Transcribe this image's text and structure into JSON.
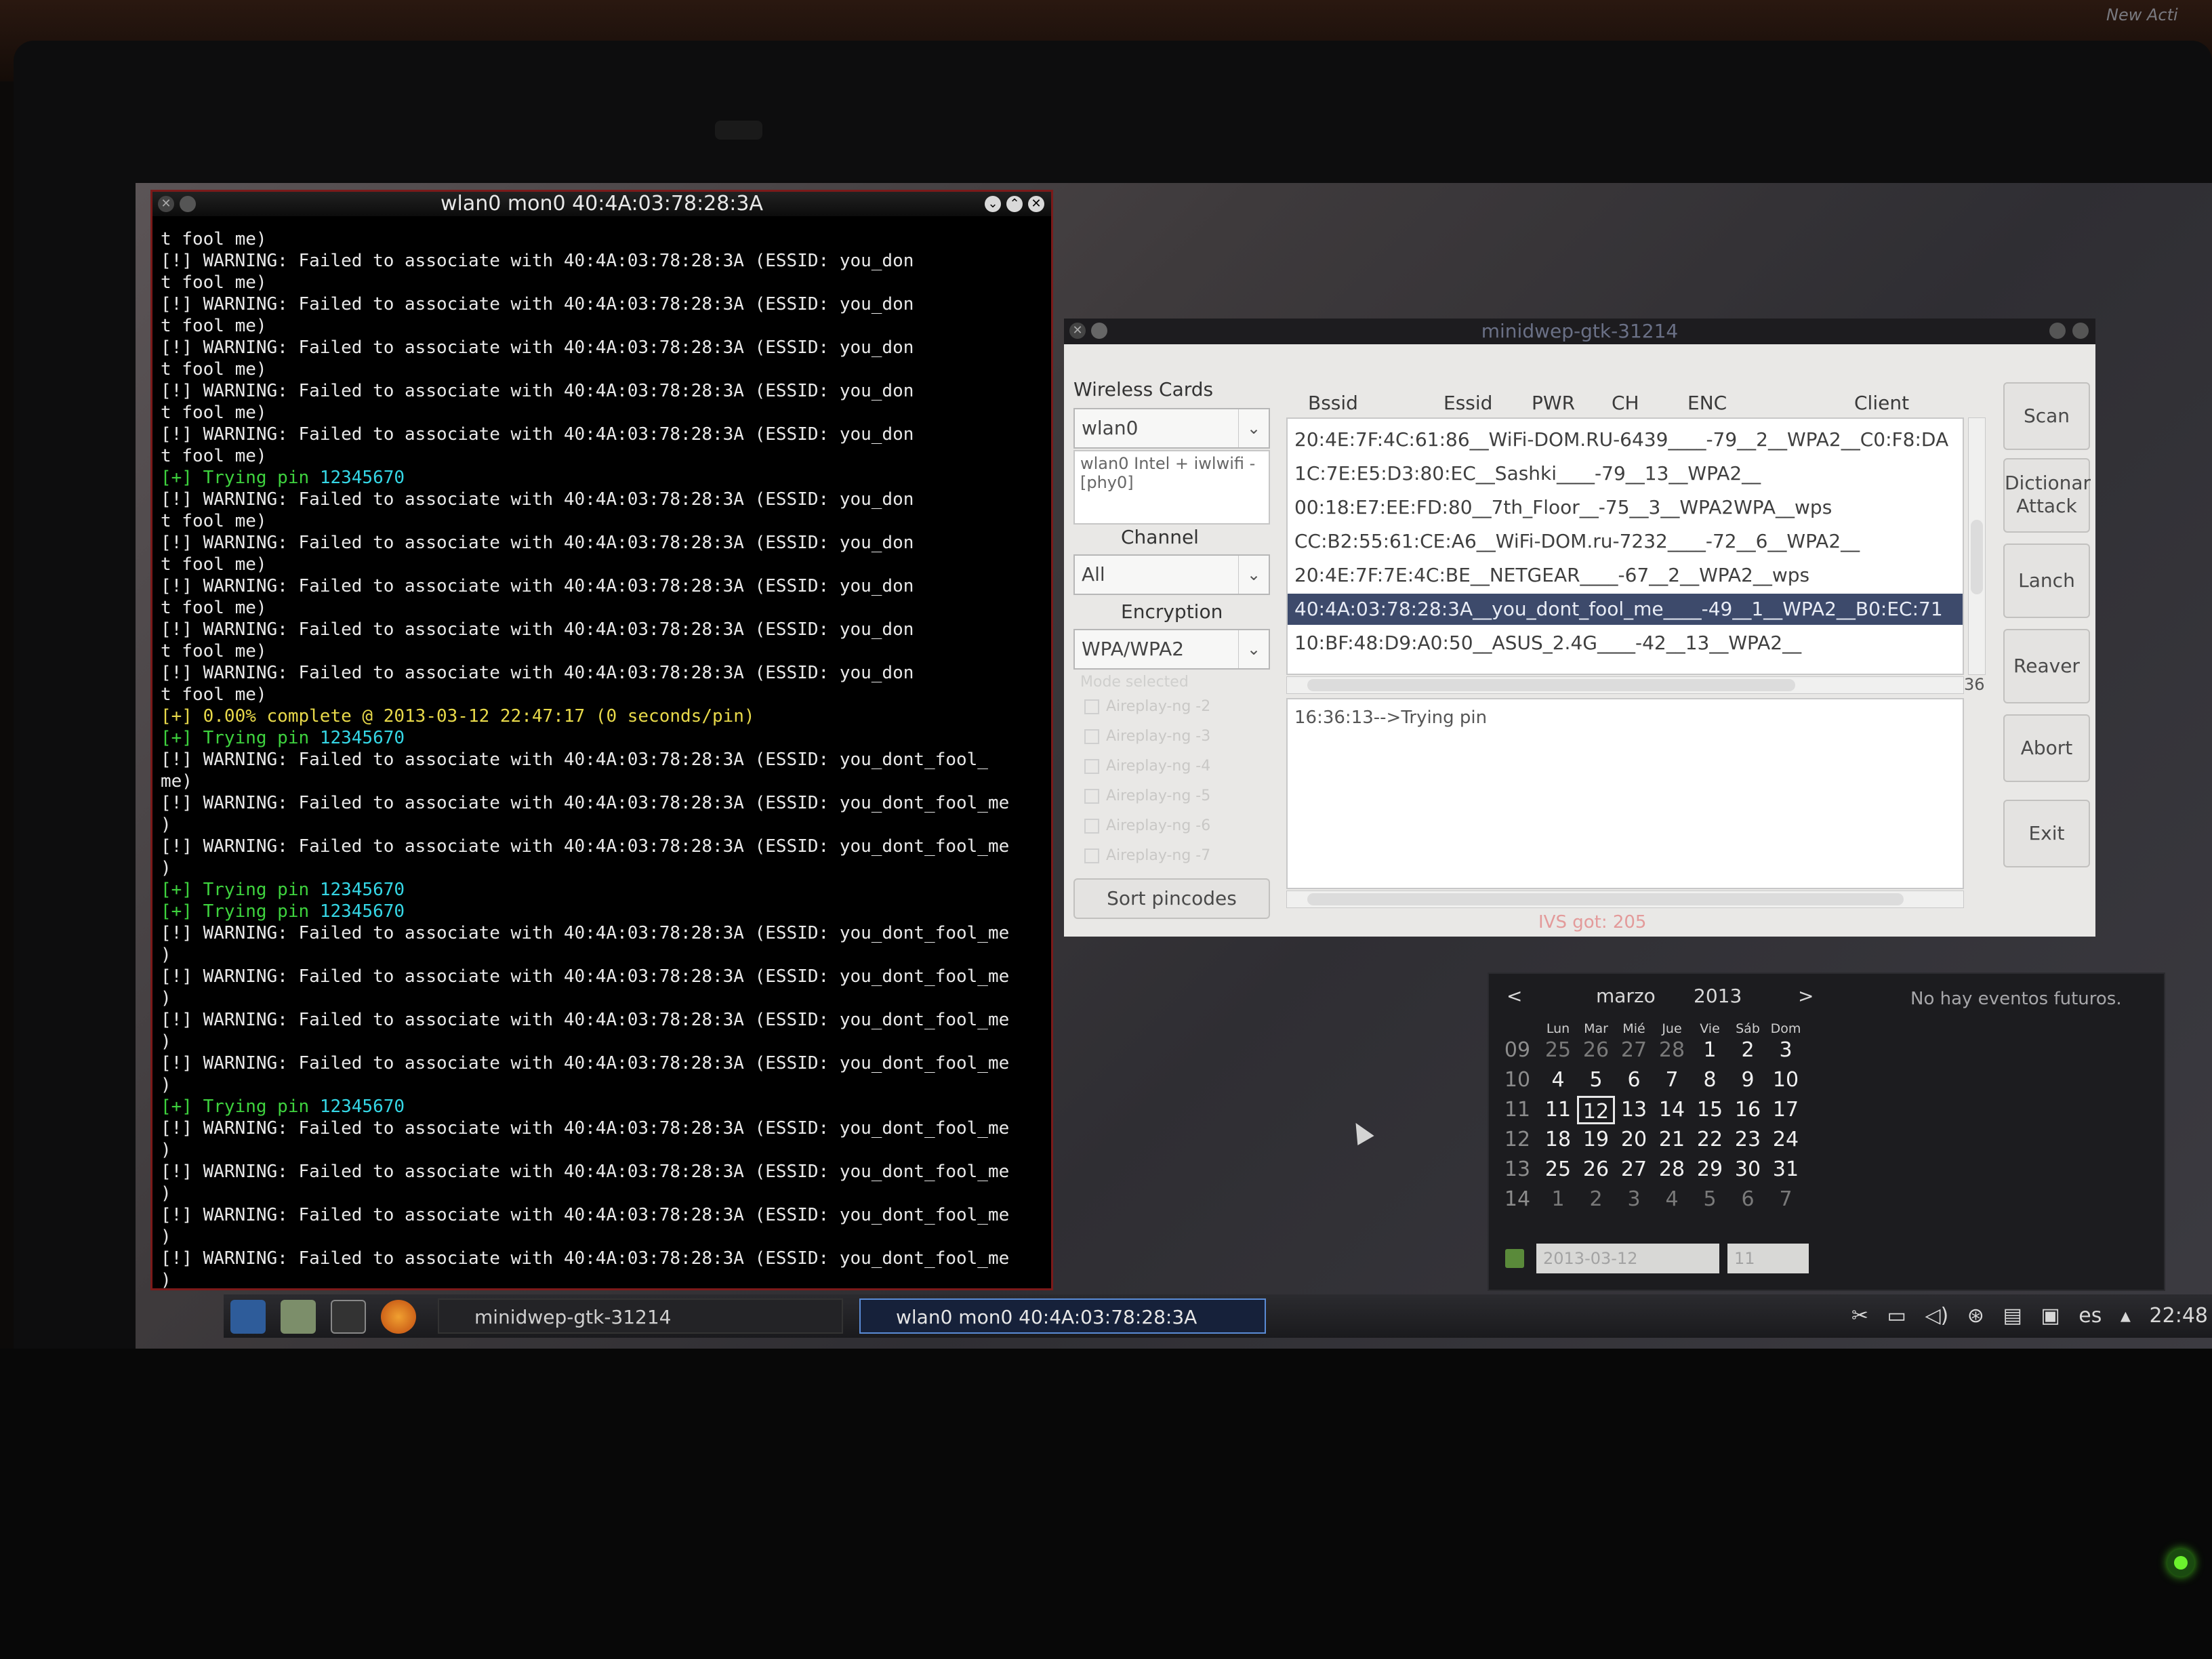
{
  "terminal": {
    "title": "wlan0 mon0 40:4A:03:78:28:3A",
    "lines": [
      {
        "t": "t fool me)"
      },
      {
        "t": "[!] WARNING: Failed to associate with 40:4A:03:78:28:3A (ESSID: you_don"
      },
      {
        "t": "t fool me)"
      },
      {
        "t": "[!] WARNING: Failed to associate with 40:4A:03:78:28:3A (ESSID: you_don"
      },
      {
        "t": "t fool me)"
      },
      {
        "t": "[!] WARNING: Failed to associate with 40:4A:03:78:28:3A (ESSID: you_don"
      },
      {
        "t": "t fool me)"
      },
      {
        "t": "[!] WARNING: Failed to associate with 40:4A:03:78:28:3A (ESSID: you_don"
      },
      {
        "t": "t fool me)"
      },
      {
        "t": "[!] WARNING: Failed to associate with 40:4A:03:78:28:3A (ESSID: you_don"
      },
      {
        "t": "t fool me)"
      },
      {
        "t": "[+] Trying pin 12345670",
        "kind": "pin"
      },
      {
        "t": "[!] WARNING: Failed to associate with 40:4A:03:78:28:3A (ESSID: you_don"
      },
      {
        "t": "t fool me)"
      },
      {
        "t": "[!] WARNING: Failed to associate with 40:4A:03:78:28:3A (ESSID: you_don"
      },
      {
        "t": "t fool me)"
      },
      {
        "t": "[!] WARNING: Failed to associate with 40:4A:03:78:28:3A (ESSID: you_don"
      },
      {
        "t": "t fool me)"
      },
      {
        "t": "[!] WARNING: Failed to associate with 40:4A:03:78:28:3A (ESSID: you_don"
      },
      {
        "t": "t fool me)"
      },
      {
        "t": "[!] WARNING: Failed to associate with 40:4A:03:78:28:3A (ESSID: you_don"
      },
      {
        "t": "t fool me)"
      },
      {
        "t": "[+] 0.00% complete @ 2013-03-12 22:47:17 (0 seconds/pin)",
        "kind": "progress"
      },
      {
        "t": "[+] Trying pin 12345670",
        "kind": "pin"
      },
      {
        "t": "[!] WARNING: Failed to associate with 40:4A:03:78:28:3A (ESSID: you_dont_fool_"
      },
      {
        "t": "me)"
      },
      {
        "t": "[!] WARNING: Failed to associate with 40:4A:03:78:28:3A (ESSID: you_dont_fool_me"
      },
      {
        "t": ")"
      },
      {
        "t": "[!] WARNING: Failed to associate with 40:4A:03:78:28:3A (ESSID: you_dont_fool_me"
      },
      {
        "t": ")"
      },
      {
        "t": "[+] Trying pin 12345670",
        "kind": "pin"
      },
      {
        "t": "[+] Trying pin 12345670",
        "kind": "pin"
      },
      {
        "t": "[!] WARNING: Failed to associate with 40:4A:03:78:28:3A (ESSID: you_dont_fool_me"
      },
      {
        "t": ")"
      },
      {
        "t": "[!] WARNING: Failed to associate with 40:4A:03:78:28:3A (ESSID: you_dont_fool_me"
      },
      {
        "t": ")"
      },
      {
        "t": "[!] WARNING: Failed to associate with 40:4A:03:78:28:3A (ESSID: you_dont_fool_me"
      },
      {
        "t": ")"
      },
      {
        "t": "[!] WARNING: Failed to associate with 40:4A:03:78:28:3A (ESSID: you_dont_fool_me"
      },
      {
        "t": ")"
      },
      {
        "t": "[+] Trying pin 12345670",
        "kind": "pin"
      },
      {
        "t": "[!] WARNING: Failed to associate with 40:4A:03:78:28:3A (ESSID: you_dont_fool_me"
      },
      {
        "t": ")"
      },
      {
        "t": "[!] WARNING: Failed to associate with 40:4A:03:78:28:3A (ESSID: you_dont_fool_me"
      },
      {
        "t": ")"
      },
      {
        "t": "[!] WARNING: Failed to associate with 40:4A:03:78:28:3A (ESSID: you_dont_fool_me"
      },
      {
        "t": ")"
      },
      {
        "t": "[!] WARNING: Failed to associate with 40:4A:03:78:28:3A (ESSID: you_dont_fool_me"
      },
      {
        "t": ")"
      }
    ]
  },
  "minidwep": {
    "title": "minidwep-gtk-31214",
    "wireless_cards_label": "Wireless Cards",
    "wireless_card_value": "wlan0",
    "card_info": "wlan0 Intel + iwlwifi - [phy0]",
    "channel_label": "Channel",
    "channel_value": "All",
    "encryption_label": "Encryption",
    "encryption_value": "WPA/WPA2",
    "mode_label": "Mode selected",
    "modes": [
      "Aireplay-ng -2",
      "Aireplay-ng -3",
      "Aireplay-ng -4",
      "Aireplay-ng -5",
      "Aireplay-ng -6",
      "Aireplay-ng -7"
    ],
    "sort_button": "Sort pincodes",
    "headers": {
      "bssid": "Bssid",
      "essid": "Essid",
      "pwr": "PWR",
      "ch": "CH",
      "enc": "ENC",
      "client": "Client"
    },
    "networks": [
      "20:4E:7F:4C:61:86__WiFi-DOM.RU-6439____-79__2__WPA2__C0:F8:DA",
      "1C:7E:E5:D3:80:EC__Sashki____-79__13__WPA2__",
      "00:18:E7:EE:FD:80__7th_Floor__-75__3__WPA2WPA__wps",
      "CC:B2:55:61:CE:A6__WiFi-DOM.ru-7232____-72__6__WPA2__",
      "20:4E:7F:7E:4C:BE__NETGEAR____-67__2__WPA2__wps",
      "40:4A:03:78:28:3A__you_dont_fool_me____-49__1__WPA2__B0:EC:71",
      "10:BF:48:D9:A0:50__ASUS_2.4G____-42__13__WPA2__"
    ],
    "selected_index": 5,
    "count": "36",
    "log_text": "16:36:13-->Trying pin",
    "status": "IVS got: 205",
    "buttons": {
      "scan": "Scan",
      "dict_line1": "Dictionar",
      "dict_line2": "Attack",
      "lanch": "Lanch",
      "reaver": "Reaver",
      "abort": "Abort",
      "exit": "Exit"
    }
  },
  "calendar": {
    "month": "marzo",
    "year": "2013",
    "prev": "<",
    "next": ">",
    "days_of_week": [
      "Lun",
      "Mar",
      "Mié",
      "Jue",
      "Vie",
      "Sáb",
      "Dom"
    ],
    "weeks": [
      {
        "wk": "09",
        "days": [
          "25",
          "26",
          "27",
          "28",
          "1",
          "2",
          "3"
        ]
      },
      {
        "wk": "10",
        "days": [
          "4",
          "5",
          "6",
          "7",
          "8",
          "9",
          "10"
        ]
      },
      {
        "wk": "11",
        "days": [
          "11",
          "12",
          "13",
          "14",
          "15",
          "16",
          "17"
        ]
      },
      {
        "wk": "12",
        "days": [
          "18",
          "19",
          "20",
          "21",
          "22",
          "23",
          "24"
        ]
      },
      {
        "wk": "13",
        "days": [
          "25",
          "26",
          "27",
          "28",
          "29",
          "30",
          "31"
        ]
      },
      {
        "wk": "14",
        "days": [
          "1",
          "2",
          "3",
          "4",
          "5",
          "6",
          "7"
        ]
      }
    ],
    "today": "12",
    "date_field": "2013-03-12",
    "week_field": "11",
    "events": "No hay eventos futuros."
  },
  "taskbar": {
    "tasks": [
      "minidwep-gtk-31214",
      "wlan0 mon0 40:4A:03:78:28:3A"
    ],
    "active_task": 1,
    "language": "es",
    "clock": "22:48"
  },
  "desktop_text": "New Acti"
}
